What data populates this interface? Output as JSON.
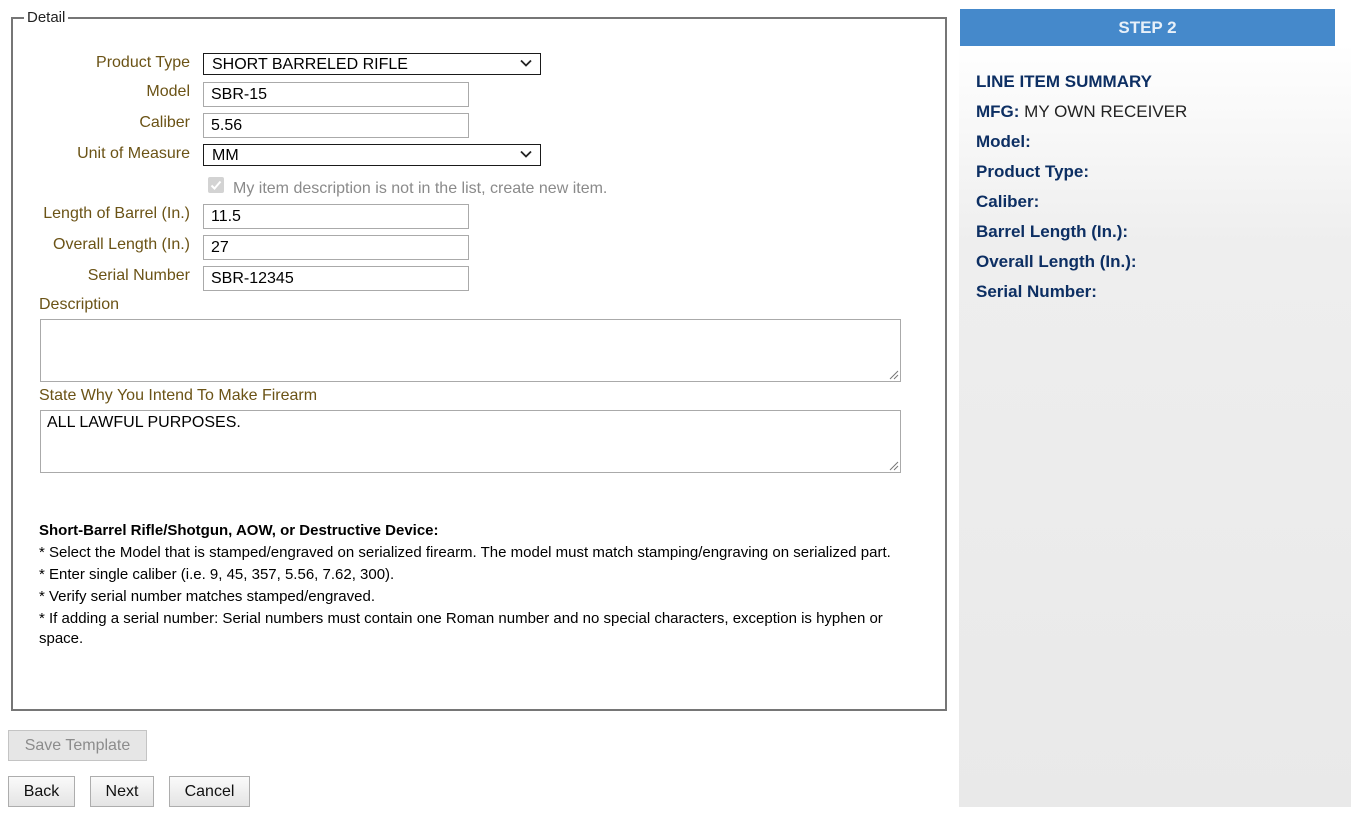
{
  "detail": {
    "legend": "Detail",
    "fields": {
      "product_type": {
        "label": "Product Type",
        "value": "SHORT BARRELED RIFLE"
      },
      "model": {
        "label": "Model",
        "value": "SBR-15"
      },
      "caliber": {
        "label": "Caliber",
        "value": "5.56"
      },
      "unit_of_measure": {
        "label": "Unit of Measure",
        "value": "MM"
      },
      "create_new_item": {
        "label": "My item description is not in the list, create new item.",
        "checked": true
      },
      "barrel_length": {
        "label": "Length of Barrel (In.)",
        "value": "11.5"
      },
      "overall_length": {
        "label": "Overall Length (In.)",
        "value": "27"
      },
      "serial_number": {
        "label": "Serial Number",
        "value": "SBR-12345"
      },
      "description": {
        "label": "Description",
        "value": ""
      },
      "intent": {
        "label": "State Why You Intend To Make Firearm",
        "value": "ALL LAWFUL PURPOSES."
      }
    },
    "notes": {
      "title": "Short-Barrel Rifle/Shotgun, AOW, or Destructive Device:",
      "items": [
        "* Select the Model that is stamped/engraved on serialized firearm. The model must match stamping/engraving on serialized part.",
        "* Enter single caliber (i.e. 9, 45, 357, 5.56, 7.62, 300).",
        "* Verify serial number matches stamped/engraved.",
        "* If adding a serial number: Serial numbers must contain one Roman number and no special characters, exception is hyphen or space."
      ]
    }
  },
  "buttons": {
    "save_template": "Save Template",
    "back": "Back",
    "next": "Next",
    "cancel": "Cancel"
  },
  "summary": {
    "step": "STEP 2",
    "title": "LINE ITEM SUMMARY",
    "rows": [
      {
        "label": "MFG:",
        "value": "MY OWN RECEIVER"
      },
      {
        "label": "Model:",
        "value": ""
      },
      {
        "label": "Product Type:",
        "value": ""
      },
      {
        "label": "Caliber:",
        "value": ""
      },
      {
        "label": "Barrel Length (In.):",
        "value": ""
      },
      {
        "label": "Overall Length (In.):",
        "value": ""
      },
      {
        "label": "Serial Number:",
        "value": ""
      }
    ]
  },
  "colors": {
    "step_header": "#4589cb",
    "summary_label": "#0d2f63",
    "form_label": "#6b5316"
  }
}
